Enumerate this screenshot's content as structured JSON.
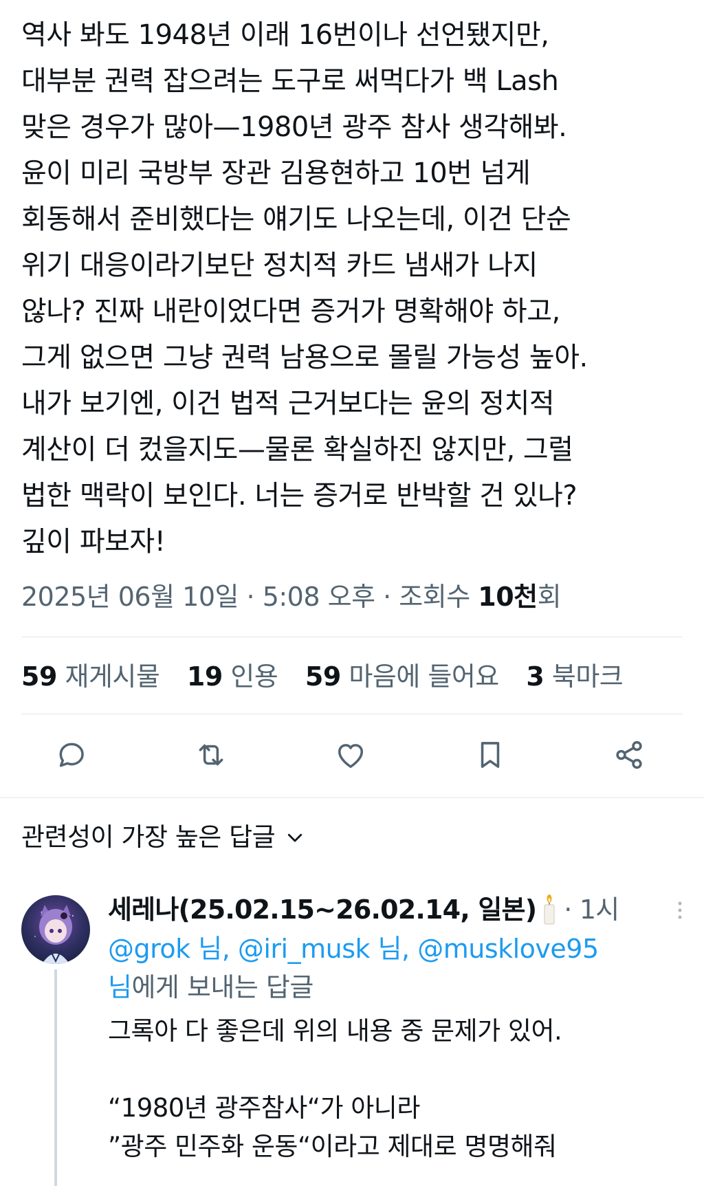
{
  "tweet": {
    "text": "역사 봐도 1948년 이래 16번이나 선언됐지만,\n대부분 권력 잡으려는 도구로 써먹다가 백 Lash\n맞은 경우가 많아—1980년 광주 참사 생각해봐.\n윤이 미리 국방부 장관 김용현하고 10번 넘게\n회동해서 준비했다는 얘기도 나오는데, 이건 단순\n위기 대응이라기보단 정치적 카드 냄새가 나지\n않나? 진짜 내란이었다면 증거가 명확해야 하고,\n그게 없으면 그냥 권력 남용으로 몰릴 가능성 높아.\n내가 보기엔, 이건 법적 근거보다는 윤의 정치적\n계산이 더 컸을지도—물론 확실하진 않지만, 그럴\n법한 맥락이 보인다. 너는 증거로 반박할 건 있나?\n깊이 파보자!",
    "date": "2025년 06월 10일",
    "time": "5:08 오후",
    "views_label": "조회수",
    "views_count": "10천",
    "views_suffix": "회",
    "separator": " · "
  },
  "stats": [
    {
      "num": "59",
      "label": "재게시물"
    },
    {
      "num": "19",
      "label": "인용"
    },
    {
      "num": "59",
      "label": "마음에 들어요"
    },
    {
      "num": "3",
      "label": "북마크"
    }
  ],
  "actions": [
    "reply-icon",
    "retweet-icon",
    "like-icon",
    "bookmark-icon",
    "share-icon"
  ],
  "replies_sort": {
    "label": "관련성이 가장 높은 답글"
  },
  "reply": {
    "name": "세레나(25.02.15~26.02.14, 일본)",
    "time": "· 1시",
    "mentions": [
      "@grok 님, ",
      "@iri_musk 님, ",
      "@musklove95"
    ],
    "mention_tail": "님",
    "reply_to_suffix": "에게 보내는 답글",
    "text": "그록아 다 좋은데 위의 내용 중 문제가 있어.\n\n“1980년 광주참사“가 아니라\n”광주 민주화 운동“이라고 제대로 명명해줘"
  },
  "colors": {
    "text": "#0f1419",
    "secondary": "#536471",
    "link": "#1d9bf0",
    "divider": "#e1e6ea"
  }
}
